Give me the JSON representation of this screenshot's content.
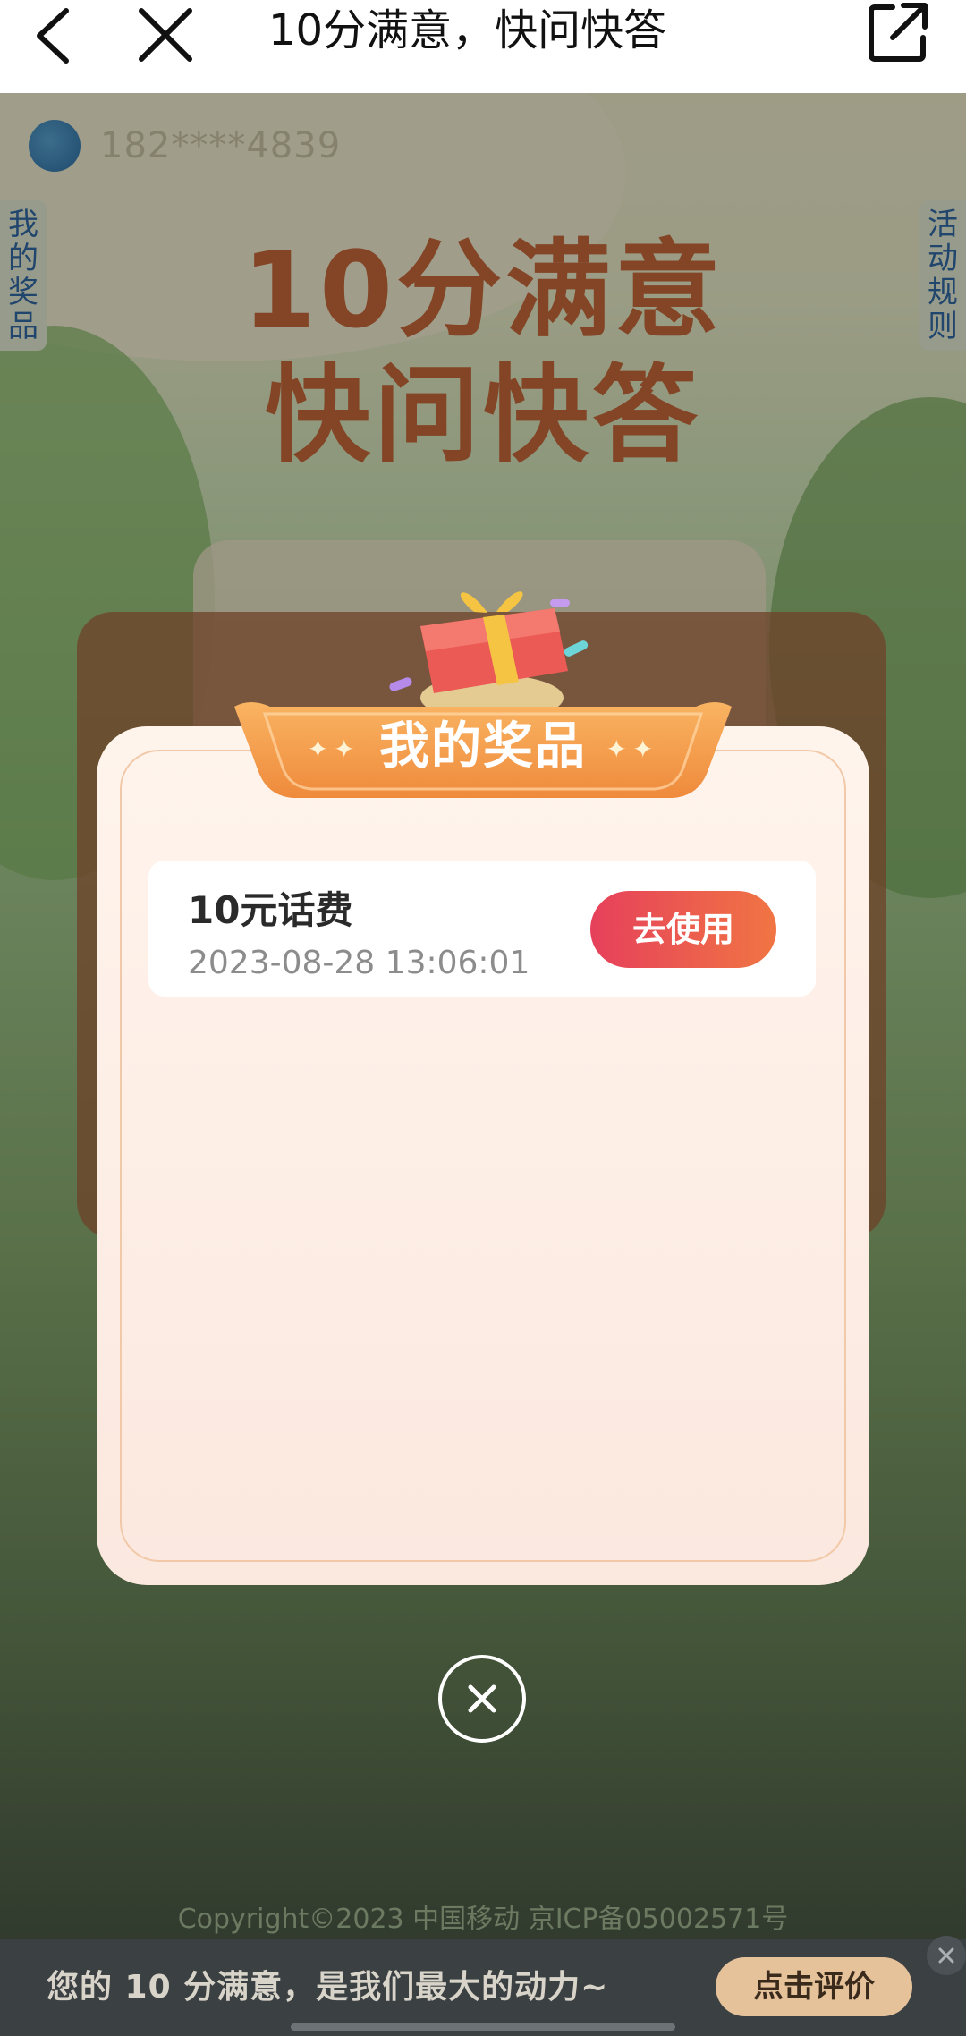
{
  "navbar": {
    "title": "10分满意，快问快答",
    "back_icon": "chevron-left-icon",
    "close_icon": "close-icon",
    "share_icon": "share-icon"
  },
  "background": {
    "phone_number": "182****4839",
    "side_left": "我的奖品",
    "side_right": "活动规则",
    "hero_line1": "10分满意",
    "hero_line2": "快问快答"
  },
  "modal": {
    "title": "我的奖品",
    "prizes": [
      {
        "name": "10元话费",
        "time": "2023-08-28 13:06:01",
        "button_label": "去使用"
      }
    ],
    "close_icon": "close-icon"
  },
  "footer": {
    "copyright": "Copyright©2023 中国移动 京ICP备05002571号"
  },
  "banner": {
    "text": "您的 10 分满意，是我们最大的动力~",
    "button_label": "点击评价"
  },
  "colors": {
    "accent": "#e6405b",
    "ribbon": "#f29a4a",
    "modal_bg": "#fff4ec",
    "banner_bg": "#3b4043"
  }
}
